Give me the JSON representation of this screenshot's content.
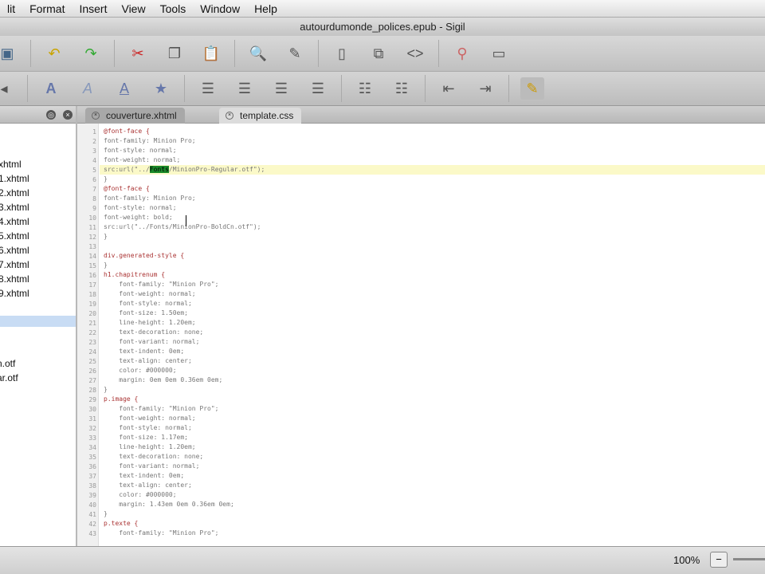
{
  "menu": [
    "lit",
    "Format",
    "Insert",
    "View",
    "Tools",
    "Window",
    "Help"
  ],
  "window_title": "autourdumonde_polices.epub - Sigil",
  "tabs": [
    {
      "label": "couverture.xhtml"
    },
    {
      "label": "template.css"
    }
  ],
  "book_browser": {
    "files": [
      "xhtml",
      "1.xhtml",
      "2.xhtml",
      "3.xhtml",
      "4.xhtml",
      "5.xhtml",
      "6.xhtml",
      "7.xhtml",
      "8.xhtml",
      "9.xhtml"
    ],
    "fonts": [
      "n.otf",
      "ar.otf"
    ]
  },
  "code": {
    "lines": [
      "@font-face {",
      "font-family: Minion Pro;",
      "font-style: normal;",
      "font-weight: normal;",
      "src:url(\"../Fonts/MinionPro-Regular.otf\");",
      "}",
      "@font-face {",
      "font-family: Minion Pro;",
      "font-style: normal;",
      "font-weight: bold;",
      "src:url(\"../Fonts/MinionPro-BoldCn.otf\");",
      "}",
      "",
      "div.generated-style {",
      "}",
      "h1.chapitrenum {",
      "    font-family: \"Minion Pro\";",
      "    font-weight: normal;",
      "    font-style: normal;",
      "    font-size: 1.50em;",
      "    line-height: 1.20em;",
      "    text-decoration: none;",
      "    font-variant: normal;",
      "    text-indent: 0em;",
      "    text-align: center;",
      "    color: #000000;",
      "    margin: 0em 0em 0.36em 0em;",
      "}",
      "p.image {",
      "    font-family: \"Minion Pro\";",
      "    font-weight: normal;",
      "    font-style: normal;",
      "    font-size: 1.17em;",
      "    line-height: 1.20em;",
      "    text-decoration: none;",
      "    font-variant: normal;",
      "    text-indent: 0em;",
      "    text-align: center;",
      "    color: #000000;",
      "    margin: 1.43em 0em 0.36em 0em;",
      "}",
      "p.texte {",
      "    font-family: \"Minion Pro\";"
    ],
    "current_line": 5,
    "highlight": {
      "line": 5,
      "before": "src:url(\"../",
      "match": "Fonts",
      "after": "/MinionPro-Regular.otf\");"
    }
  },
  "status": {
    "zoom": "100%",
    "zoom_out": "−"
  }
}
